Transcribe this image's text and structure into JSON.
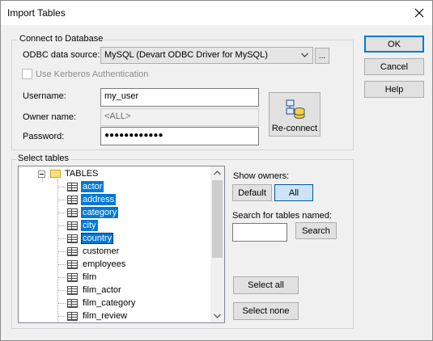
{
  "window": {
    "title": "Import Tables"
  },
  "dialog_buttons": {
    "ok": "OK",
    "cancel": "Cancel",
    "help": "Help"
  },
  "connect": {
    "group_label": "Connect to Database",
    "odbc_label": "ODBC data source:",
    "odbc_value": "MySQL (Devart ODBC Driver for MySQL)",
    "browse_label": "...",
    "kerberos_label": "Use Kerberos Authentication",
    "username_label": "Username:",
    "username_value": "my_user",
    "owner_label": "Owner name:",
    "owner_value": "<ALL>",
    "password_label": "Password:",
    "password_value": "●●●●●●●●●●●●",
    "reconnect_label": "Re-connect"
  },
  "select_tables": {
    "group_label": "Select tables",
    "root_label": "TABLES",
    "tables": [
      {
        "name": "actor",
        "selected": true
      },
      {
        "name": "address",
        "selected": true
      },
      {
        "name": "category",
        "selected": true
      },
      {
        "name": "city",
        "selected": true
      },
      {
        "name": "country",
        "selected": true
      },
      {
        "name": "customer",
        "selected": false
      },
      {
        "name": "employees",
        "selected": false
      },
      {
        "name": "film",
        "selected": false
      },
      {
        "name": "film_actor",
        "selected": false
      },
      {
        "name": "film_category",
        "selected": false
      },
      {
        "name": "film_review",
        "selected": false
      }
    ],
    "show_owners_label": "Show owners:",
    "default_label": "Default",
    "all_label": "All",
    "search_label": "Search for tables named:",
    "search_value": "",
    "search_button": "Search",
    "select_all": "Select all",
    "select_none": "Select none"
  },
  "colors": {
    "accent": "#0078d7",
    "selection": "#0078d7"
  }
}
